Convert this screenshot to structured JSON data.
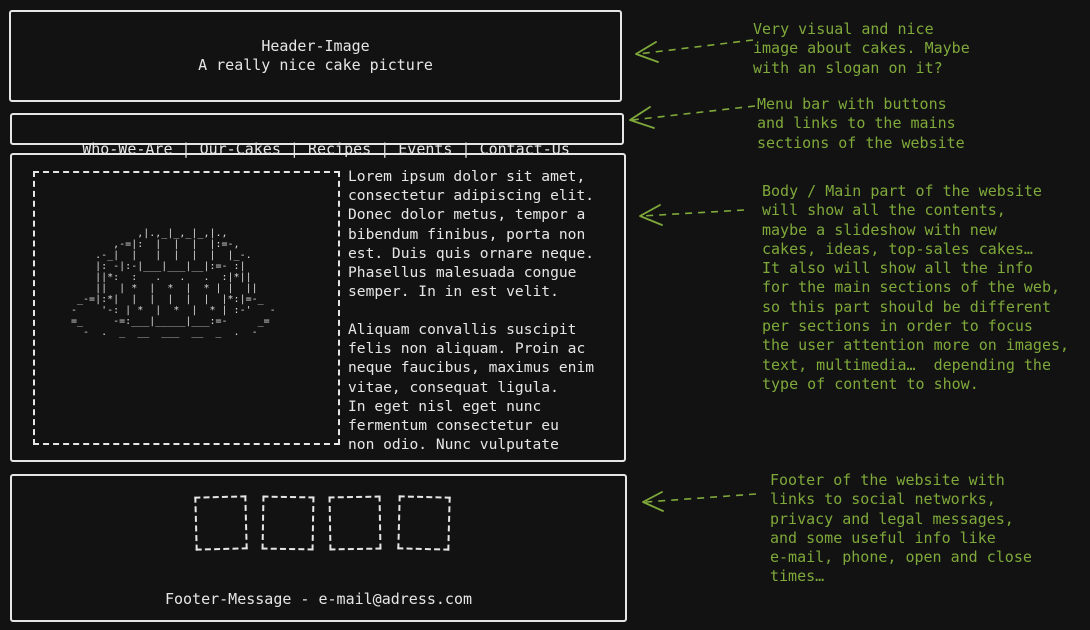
{
  "header": {
    "title": "Header-Image",
    "subtitle": "A really nice cake picture"
  },
  "menu": {
    "items": [
      "Who-We-Are",
      "Our-Cakes",
      "Recipes",
      "Events",
      "Contact-Us"
    ],
    "separator": " | "
  },
  "main": {
    "image_ascii": "           ,|.,_|_,_|_,|.,\n       ,-=|:  |  |  |  |:=-,\n    .-_|  |   |  |  |  |  |_-.\n    |: -|:-|___|___|__|:=- :|\n    ||*:  :   .   .   .  :|*||\n    ||  | *  |  *  |  * | |  ||\n _-=|:*|  |  |  |  |  |  |*:|=-_\n-    '-: | *  |  *  |  * | :-'   -\n=_     -=:___|_____|___:=-     _=\n  -  .  _  __  ___  __  _  .  -",
    "paragraph1": "Lorem ipsum dolor sit amet,\nconsectetur adipiscing elit.\nDonec dolor metus, tempor a\nbibendum finibus, porta non\nest. Duis quis ornare neque.\nPhasellus malesuada congue\nsemper. In in est velit.",
    "paragraph2": "Aliquam convallis suscipit\nfelis non aliquam. Proin ac\nneque faucibus, maximus enim\nvitae, consequat ligula.\nIn eget nisl eget nunc\nfermentum consectetur eu\nnon odio. Nunc vulputate"
  },
  "footer": {
    "message": "Footer-Message - e-mail@adress.com",
    "social_icons": [
      "social-link-1",
      "social-link-2",
      "social-link-3",
      "social-link-4"
    ]
  },
  "annotations": {
    "header": "Very visual and nice\nimage about cakes. Maybe\nwith an slogan on it?",
    "menu": "Menu bar with buttons\nand links to the mains\nsections of the website",
    "body": "Body / Main part of the website\nwill show all the contents,\nmaybe a slideshow with new\ncakes, ideas, top-sales cakes…\nIt also will show all the info\nfor the main sections of the web,\nso this part should be different\nper sections in order to focus\nthe user attention more on images,\ntext, multimedia…  depending the\ntype of content to show.",
    "footer": "Footer of the website with\nlinks to social networks,\nprivacy and legal messages,\nand some useful info like\ne-mail, phone, open and close\ntimes…"
  },
  "colors": {
    "background": "#121212",
    "sketch": "#e6e6e6",
    "annotation": "#7fa93a"
  }
}
